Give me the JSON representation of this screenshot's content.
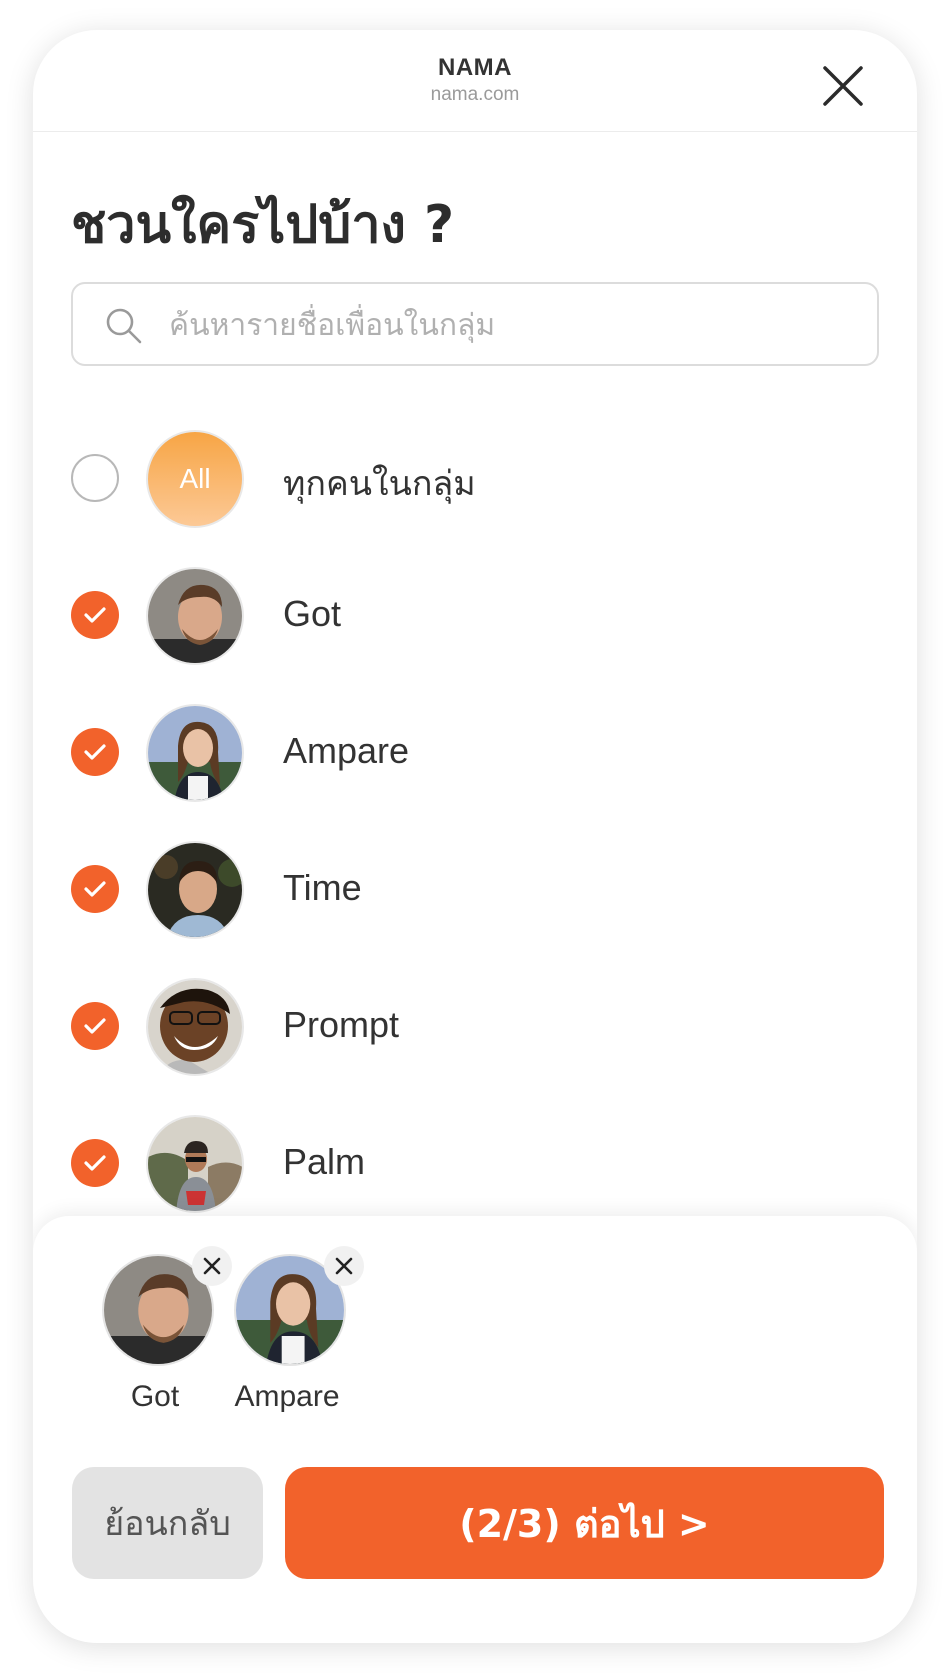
{
  "header": {
    "site_name": "NAMA",
    "site_url": "nama.com"
  },
  "title": "ชวนใครไปบ้าง ?",
  "search": {
    "placeholder": "ค้นหารายชื่อเพื่อนในกลุ่ม",
    "value": ""
  },
  "list": {
    "all": {
      "avatar_label": "All",
      "name": "ทุกคนในกลุ่ม",
      "checked": false
    },
    "friends": [
      {
        "name": "Got",
        "checked": true
      },
      {
        "name": "Ampare",
        "checked": true
      },
      {
        "name": "Time",
        "checked": true
      },
      {
        "name": "Prompt",
        "checked": true
      },
      {
        "name": "Palm",
        "checked": true
      }
    ]
  },
  "selected": [
    {
      "name": "Got"
    },
    {
      "name": "Ampare"
    }
  ],
  "buttons": {
    "back_label": "ย้อนกลับ",
    "next_label": "(2/3) ต่อไป >"
  },
  "colors": {
    "accent": "#f2622b",
    "all_avatar_top": "#f7a545",
    "all_avatar_bottom": "#fcc996",
    "back_button_bg": "#e3e3e3"
  }
}
